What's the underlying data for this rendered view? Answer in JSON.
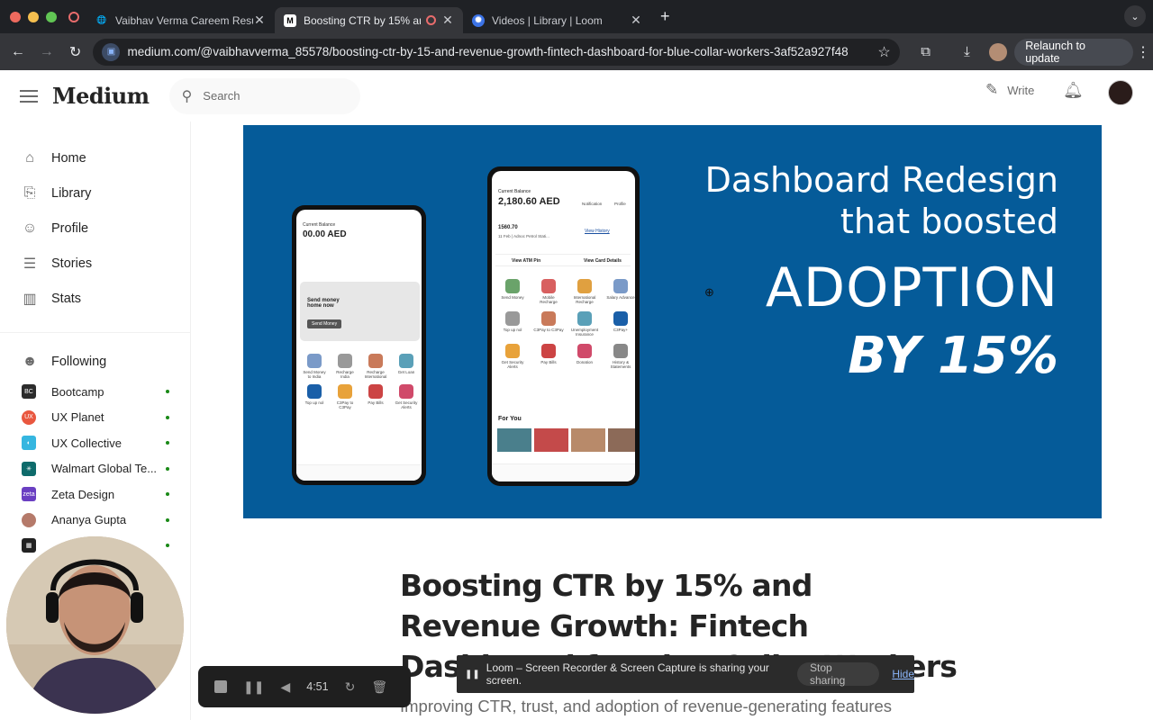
{
  "browser": {
    "tabs": [
      {
        "title": "Vaibhav Verma Careem Resu",
        "active": false
      },
      {
        "title": "Boosting CTR by 15% and",
        "active": true
      },
      {
        "title": "Videos | Library | Loom",
        "active": false
      }
    ],
    "new_tab": "+",
    "url": "medium.com/@vaibhavverma_85578/boosting-ctr-by-15-and-revenue-growth-fintech-dashboard-for-blue-collar-workers-3af52a927f48",
    "relaunch_label": "Relaunch to update"
  },
  "medium": {
    "logo": "Medium",
    "search_placeholder": "Search",
    "write_label": "Write",
    "nav": [
      "Home",
      "Library",
      "Profile",
      "Stories",
      "Stats"
    ],
    "following_label": "Following",
    "following": [
      {
        "name": "Bootcamp",
        "color": "#2c2c2c"
      },
      {
        "name": "UX Planet",
        "color": "#e9573f"
      },
      {
        "name": "UX Collective",
        "color": "#35b6e0"
      },
      {
        "name": "Walmart Global Te...",
        "color": "#0e6b6b"
      },
      {
        "name": "Zeta Design",
        "color": "#6a3fc2"
      },
      {
        "name": "Ananya Gupta",
        "color": "#b57a6a"
      }
    ]
  },
  "hero": {
    "line1": "Dashboard Redesign",
    "line2": "that boosted",
    "line3": "ADOPTION",
    "line4": "BY 15%",
    "background": "#055b99",
    "phone_left": {
      "balance_label": "Current Balance",
      "balance": "00.00 AED",
      "promo": "Send money home now",
      "promo_button": "Send Money",
      "apps": [
        "Send Money to India",
        "Recharge India",
        "Recharge International",
        "Get Loan",
        "Top up nol",
        "C3Pay to C3Pay",
        "Pay Bills",
        "Get Security Alerts"
      ]
    },
    "phone_right": {
      "balance_label": "Current Balance",
      "balance": "2,180.60 AED",
      "notification": "Notification",
      "profile": "Profile",
      "txn_amount": "1560.70",
      "txn_desc": "11 Feb | Adnoc Petrol Stati...",
      "history": "View History",
      "atm": "View ATM Pin",
      "card": "View Card Details",
      "apps": [
        "Send Money",
        "Mobile Recharge",
        "International Recharge",
        "Salary Advance",
        "Top up nol",
        "C3Pay to C3Pay",
        "Unemployment Insurance",
        "C3Pay+",
        "Get Security Alerts",
        "Pay Bills",
        "Donation",
        "History & Statements"
      ],
      "for_you": "For You"
    }
  },
  "article": {
    "title": "Boosting CTR by 15% and Revenue Growth: Fintech Dashboard for Blue Collar Workers",
    "subtitle": "Improving CTR, trust, and adoption of revenue-generating features"
  },
  "loom": {
    "sharing_text": "Loom – Screen Recorder & Screen Capture is sharing your screen.",
    "stop_label": "Stop sharing",
    "hide_label": "Hide",
    "timer": "4:51"
  }
}
